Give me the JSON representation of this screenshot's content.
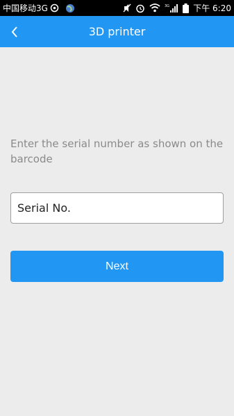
{
  "status_bar": {
    "carrier": "中国移动3G",
    "time": "下午 6:20",
    "network_label": "3G",
    "icons": [
      "usb-debug-icon",
      "globe-icon",
      "mute-icon",
      "alarm-icon",
      "wifi-icon",
      "signal-icon",
      "battery-icon"
    ]
  },
  "app_bar": {
    "title": "3D printer",
    "back_icon": "chevron-left-icon",
    "color": "#2196f3"
  },
  "instruction": "Enter the serial number as shown on the barcode",
  "serial_field": {
    "label": "Serial No.",
    "value": "",
    "placeholder": ""
  },
  "next_button": {
    "label": "Next",
    "color": "#2196f3"
  },
  "colors": {
    "background": "#ececec",
    "accent": "#2196f3",
    "instruction_text": "#8a8a8a"
  }
}
